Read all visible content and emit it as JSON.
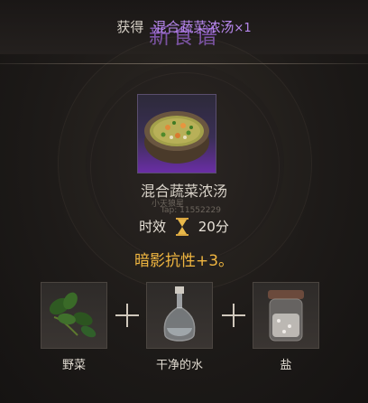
{
  "banner": {
    "title": "新食谱",
    "obtain_label": "获得",
    "obtain_item": "混合蔬菜浓汤",
    "obtain_count": "×1"
  },
  "dish": {
    "name": "混合蔬菜浓汤",
    "watermark_line1": "小天狼星",
    "watermark_line2": "Tap: 11552229",
    "duration_label": "时效",
    "duration_value": "20分",
    "effect": "暗影抗性+3。",
    "icon": "soup-bowl-icon"
  },
  "ingredients": [
    {
      "label": "野菜",
      "icon": "wild-greens-icon"
    },
    {
      "label": "干净的水",
      "icon": "water-bottle-icon"
    },
    {
      "label": "盐",
      "icon": "salt-jar-icon"
    }
  ],
  "colors": {
    "rare_purple": "#b888ee",
    "effect_gold": "#f0b640"
  }
}
